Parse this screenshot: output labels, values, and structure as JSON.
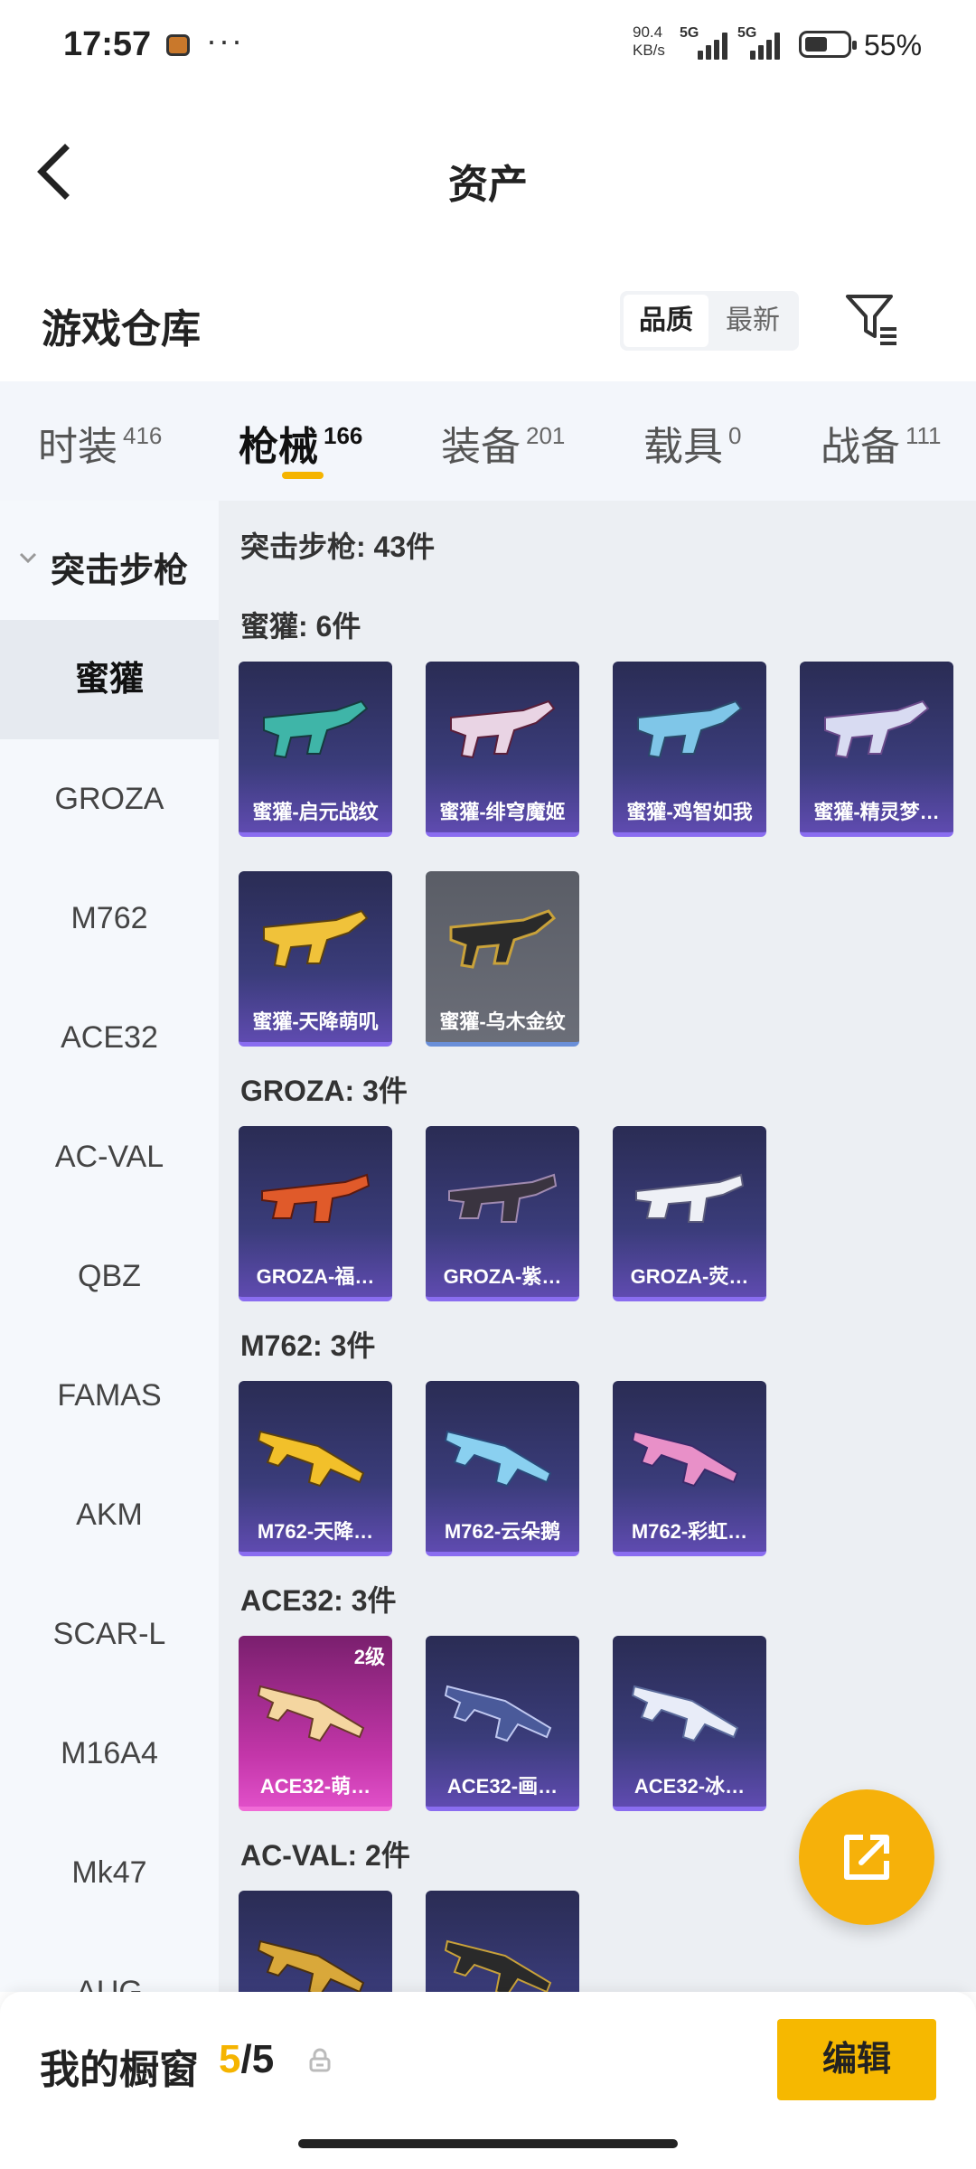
{
  "status_bar": {
    "time": "17:57",
    "more": "···",
    "net_speed_value": "90.4",
    "net_speed_unit": "KB/s",
    "sig1": "5G",
    "sig2": "5G",
    "battery_level": 0.55,
    "battery_pct": "55%"
  },
  "header": {
    "title": "资产"
  },
  "warehouse": {
    "title": "游戏仓库",
    "sort_quality": "品质",
    "sort_newest": "最新"
  },
  "tabs": [
    {
      "label": "时装",
      "count": "416"
    },
    {
      "label": "枪械",
      "count": "166"
    },
    {
      "label": "装备",
      "count": "201"
    },
    {
      "label": "载具",
      "count": "0"
    },
    {
      "label": "战备",
      "count": "111"
    }
  ],
  "sidebar": {
    "category": "突击步枪",
    "items": [
      "蜜獾",
      "GROZA",
      "M762",
      "ACE32",
      "AC-VAL",
      "QBZ",
      "FAMAS",
      "AKM",
      "SCAR-L",
      "M16A4",
      "Mk47",
      "AUG"
    ]
  },
  "content": {
    "total": "突击步枪: 43件",
    "sections": [
      {
        "title": "蜜獾: 6件",
        "items": [
          "蜜獾-启元战纹",
          "蜜獾-绯穹魔姬",
          "蜜獾-鸡智如我",
          "蜜獾-精灵梦…",
          "蜜獾-天降萌叽",
          "蜜獾-乌木金纹"
        ]
      },
      {
        "title": "GROZA: 3件",
        "items": [
          "GROZA-福…",
          "GROZA-紫…",
          "GROZA-荧…"
        ]
      },
      {
        "title": "M762: 3件",
        "items": [
          "M762-天降…",
          "M762-云朵鹅",
          "M762-彩虹…"
        ]
      },
      {
        "title": "ACE32: 3件",
        "items": [
          "ACE32-萌…",
          "ACE32-画…",
          "ACE32-冰…"
        ],
        "level": "2级"
      },
      {
        "title": "AC-VAL: 2件",
        "items": [
          "",
          ""
        ]
      }
    ]
  },
  "bottom_bar": {
    "label": "我的橱窗",
    "current": "5",
    "total": "/5",
    "edit": "编辑"
  },
  "colors": {
    "accent": "#f5b400",
    "card_purple": "#3a3c7a",
    "card_pink": "#c336a9"
  }
}
